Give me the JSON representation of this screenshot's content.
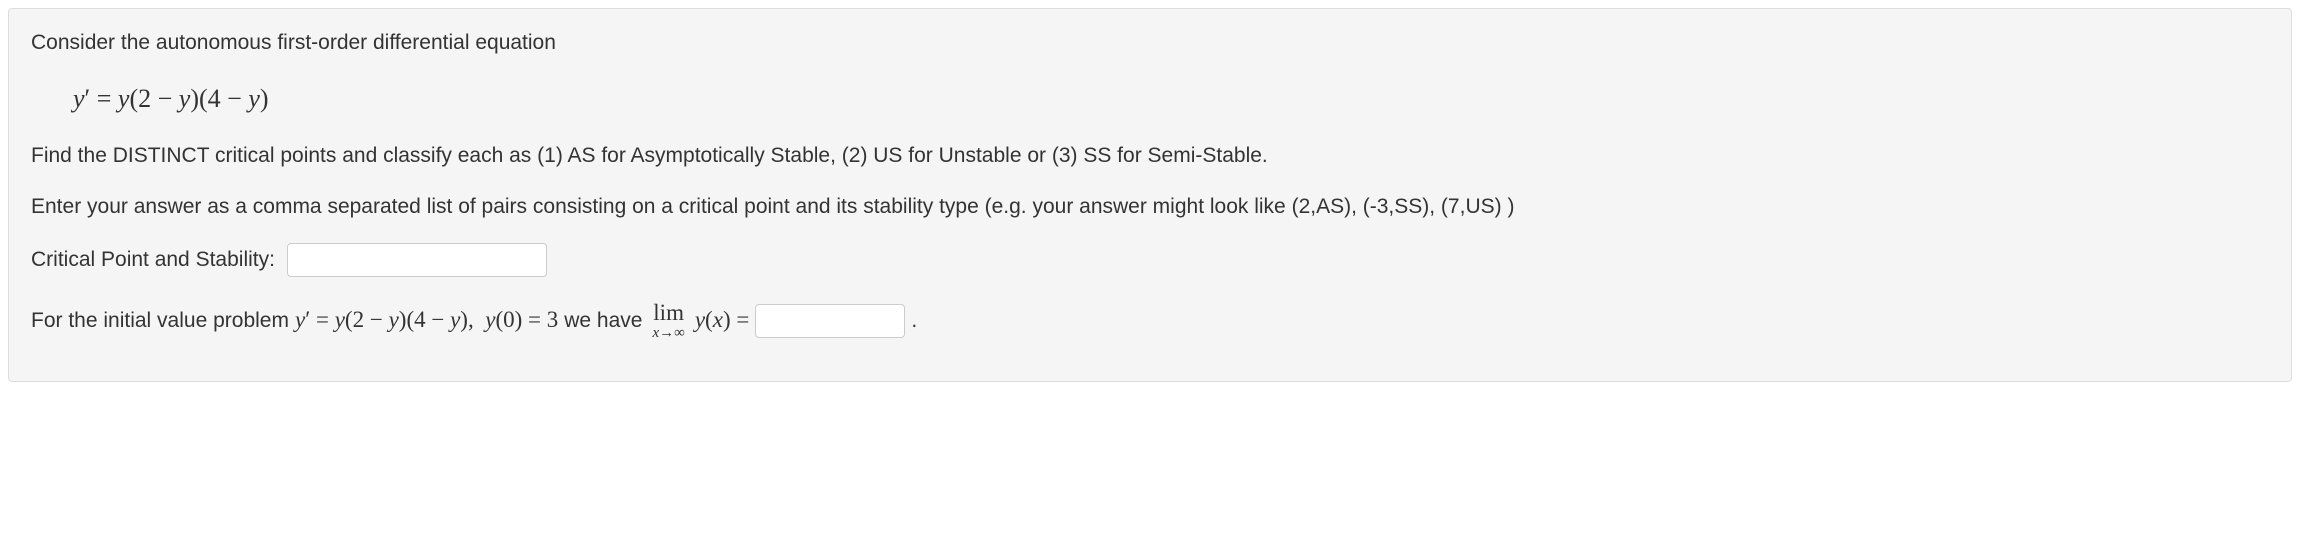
{
  "intro": "Consider the autonomous first-order differential equation",
  "equation_main": "y′ = y(2 − y)(4 − y)",
  "instruction1": "Find the DISTINCT critical points and classify each as (1) AS for Asymptotically Stable, (2) US for Unstable or (3) SS for Semi-Stable.",
  "instruction2": "Enter your answer as a comma separated list of pairs consisting on a critical point and its stability type (e.g. your answer might look like (2,AS), (-3,SS), (7,US) )",
  "label_critical": "Critical Point and Stability:",
  "ivp_prefix": "For the initial value problem ",
  "ivp_eq": "y′ = y(2 − y)(4 − y),   y(0) = 3",
  "ivp_mid": " we have ",
  "limit_top": "lim",
  "limit_bottom": "x→∞",
  "ivp_after_limit": "y(x) = ",
  "period": " .",
  "inputs": {
    "critical_value": "",
    "limit_value": ""
  }
}
